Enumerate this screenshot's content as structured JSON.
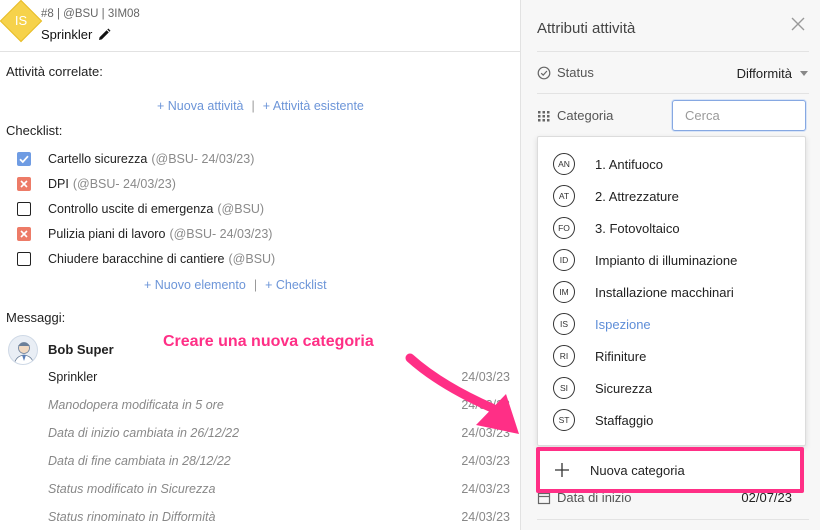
{
  "ticket": {
    "avatar_initials": "IS",
    "meta": "#8 | @BSU | 3IM08",
    "title": "Sprinkler"
  },
  "related": {
    "label": "Attività correlate:",
    "new_link": "+ Nuova attività",
    "separator": "|",
    "existing_link": "+ Attività esistente"
  },
  "checklist": {
    "label": "Checklist:",
    "items": [
      {
        "text": "Cartello sicurezza",
        "meta": "(@BSU- 24/03/23)",
        "state": "checked"
      },
      {
        "text": "DPI",
        "meta": "(@BSU- 24/03/23)",
        "state": "failed"
      },
      {
        "text": "Controllo uscite di emergenza",
        "meta": "(@BSU)",
        "state": "unchecked"
      },
      {
        "text": "Pulizia piani di lavoro",
        "meta": "(@BSU- 24/03/23)",
        "state": "failed"
      },
      {
        "text": "Chiudere baracchine di cantiere",
        "meta": "(@BSU)",
        "state": "unchecked"
      }
    ],
    "new_item_link": "+ Nuovo elemento",
    "separator": "|",
    "checklist_link": "+ Checklist"
  },
  "messages": {
    "label": "Messaggi:",
    "author": "Bob Super",
    "rows": [
      {
        "text": "Sprinkler",
        "date": "24/03/23",
        "italic": false
      },
      {
        "text": "Manodopera modificata in 5 ore",
        "date": "24/03/23",
        "italic": true
      },
      {
        "text": "Data di inizio cambiata in 26/12/22",
        "date": "24/03/23",
        "italic": true
      },
      {
        "text": "Data di fine cambiata in 28/12/22",
        "date": "24/03/23",
        "italic": true
      },
      {
        "text": "Status modificato in Sicurezza",
        "date": "24/03/23",
        "italic": true
      },
      {
        "text": "Status rinominato in Difformità",
        "date": "24/03/23",
        "italic": true
      }
    ]
  },
  "annotation": {
    "text": "Creare una nuova categoria",
    "color": "#ff2f86"
  },
  "panel": {
    "title": "Attributi attività",
    "status_label": "Status",
    "status_value": "Difformità",
    "category_label": "Categoria",
    "search_placeholder": "Cerca",
    "behind_label": "Data di inizio",
    "behind_value": "02/07/23"
  },
  "categories": [
    {
      "code": "AN",
      "label": "1. Antifuoco",
      "active": false
    },
    {
      "code": "AT",
      "label": "2. Attrezzature",
      "active": false
    },
    {
      "code": "FO",
      "label": "3. Fotovoltaico",
      "active": false
    },
    {
      "code": "ID",
      "label": "Impianto di illuminazione",
      "active": false
    },
    {
      "code": "IM",
      "label": "Installazione macchinari",
      "active": false
    },
    {
      "code": "IS",
      "label": "Ispezione",
      "active": true
    },
    {
      "code": "RI",
      "label": "Rifiniture",
      "active": false
    },
    {
      "code": "SI",
      "label": "Sicurezza",
      "active": false
    },
    {
      "code": "ST",
      "label": "Staffaggio",
      "active": false
    }
  ],
  "new_category": {
    "label": "Nuova categoria"
  },
  "colors": {
    "accent_link": "#6c95d8",
    "checked": "#6f9ce3",
    "failed": "#ed7b67",
    "highlight": "#ff2f86",
    "avatar": "#f6d24b"
  },
  "icons": {
    "edit": "pencil-icon",
    "close": "close-icon",
    "status": "check-circle-icon",
    "category": "grid-icon",
    "add": "plus-icon",
    "calendar": "calendar-icon"
  }
}
